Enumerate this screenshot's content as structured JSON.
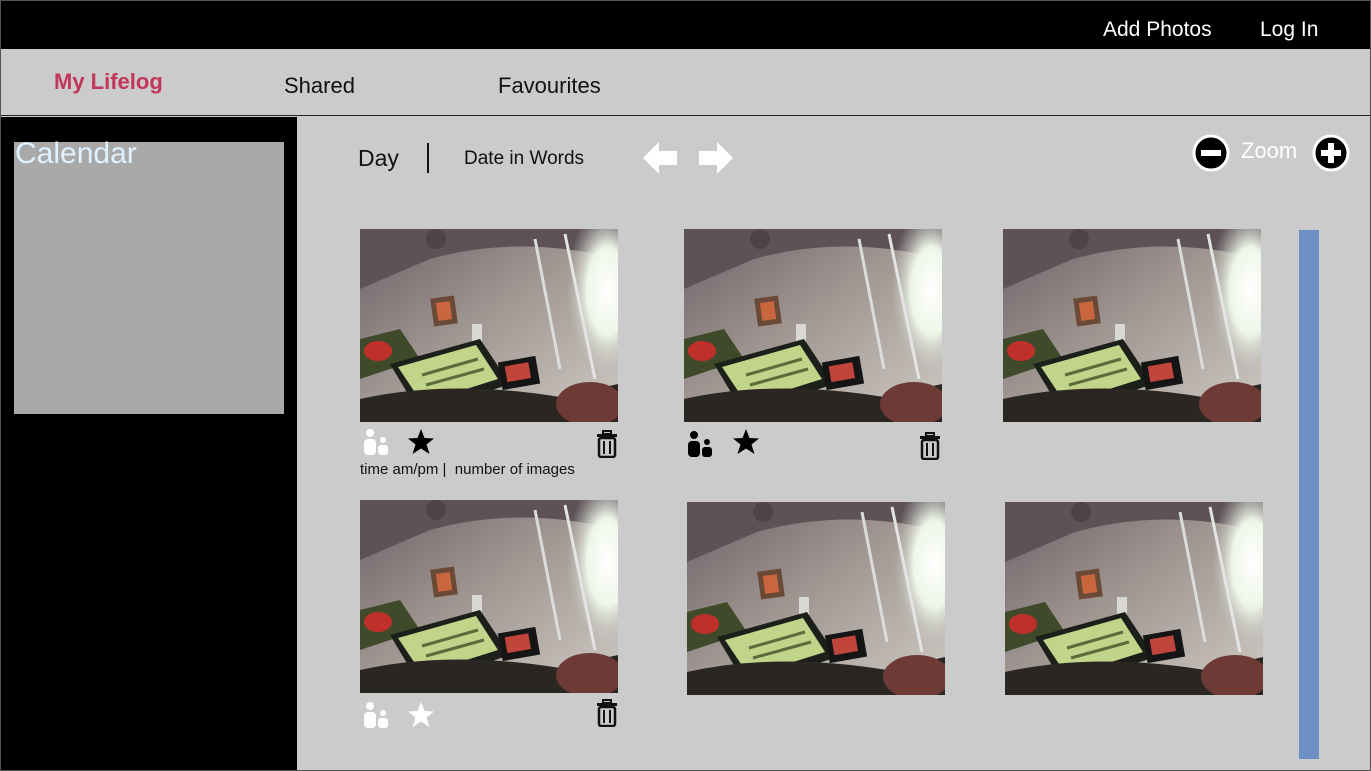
{
  "topbar": {
    "add_photos": "Add Photos",
    "log_in": "Log In"
  },
  "nav": {
    "tabs": [
      {
        "label": "My Lifelog",
        "active": true
      },
      {
        "label": "Shared"
      },
      {
        "label": "Favourites"
      }
    ]
  },
  "sidebar": {
    "calendar_title": "Calendar"
  },
  "toolbar": {
    "day": "Day",
    "date_words": "Date in Words",
    "zoom": "Zoom",
    "icons": {
      "prev": "arrow-left-icon",
      "next": "arrow-right-icon",
      "zoom_out": "minus-circle-icon",
      "zoom_in": "plus-circle-icon"
    }
  },
  "photos": [
    {
      "people": "people-icon-white",
      "favourite": "star-filled"
    },
    {
      "people": "people-icon-black",
      "favourite": "star-filled"
    },
    {},
    {
      "people": "people-icon-white",
      "favourite": "star-outline"
    },
    {},
    {}
  ],
  "caption": {
    "time": "time am/pm",
    "count": "number of images"
  },
  "colors": {
    "accent": "#c2365a",
    "scrollbar": "#6c90c4",
    "calendar_title": "#dff2ff"
  }
}
